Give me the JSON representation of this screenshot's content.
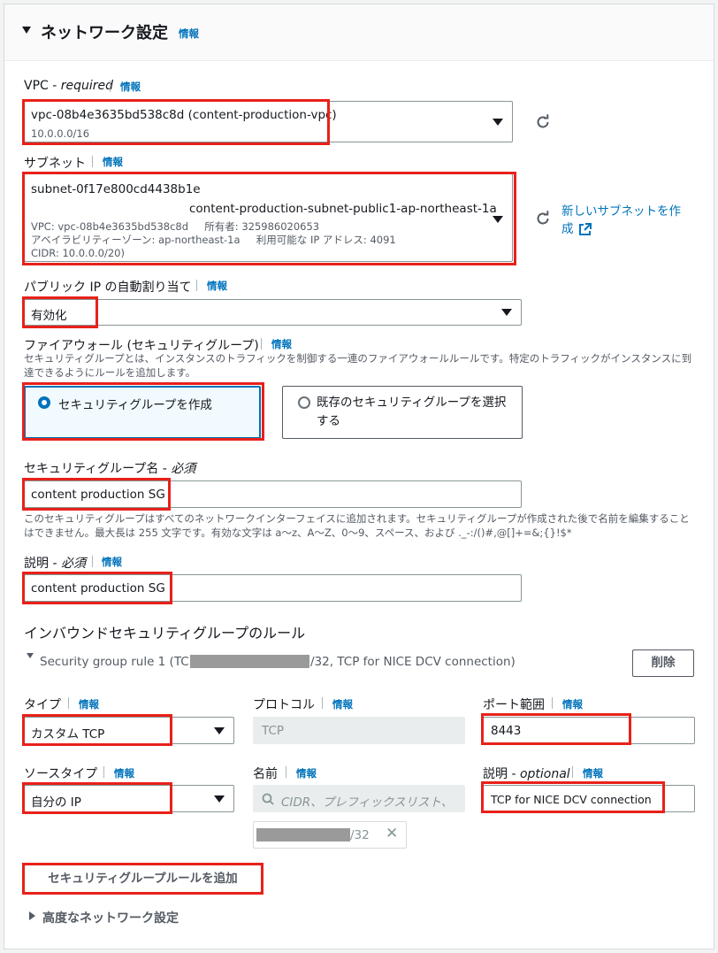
{
  "section": {
    "title": "ネットワーク設定",
    "info": "情報"
  },
  "vpc": {
    "label": "VPC - ",
    "label_italic": "required",
    "info": "情報",
    "value": "vpc-08b4e3635bd538c8d (content-production-vpc)",
    "sub": "10.0.0.0/16"
  },
  "subnet": {
    "label": "サブネット",
    "info": "情報",
    "id": "subnet-0f17e800cd4438b1e",
    "name": "content-production-subnet-public1-ap-northeast-1a",
    "detail1": "VPC: vpc-08b4e3635bd538c8d     所有者: 325986020653",
    "detail2": "アベイラビリティーゾーン: ap-northeast-1a     利用可能な IP アドレス: 4091",
    "detail3": "CIDR: 10.0.0.0/20)",
    "new_link": "新しいサブネットを作成"
  },
  "public_ip": {
    "label": "パブリック IP の自動割り当て",
    "info": "情報",
    "value": "有効化"
  },
  "firewall": {
    "label": "ファイアウォール (セキュリティグループ)",
    "info": "情報",
    "desc": "セキュリティグループとは、インスタンスのトラフィックを制御する一連のファイアウォールルールです。特定のトラフィックがインスタンスに到達できるようにルールを追加します。",
    "option_create": "セキュリティグループを作成",
    "option_existing": "既存のセキュリティグループを選択する"
  },
  "sg_name": {
    "label": "セキュリティグループ名 - ",
    "label_italic": "必須",
    "value": "content production SG",
    "hint": "このセキュリティグループはすべてのネットワークインターフェイスに追加されます。セキュリティグループが作成された後で名前を編集することはできません。最大長は 255 文字です。有効な文字は a〜z、A〜Z、0〜9、スペース、および ._-:/()#,@[]+=&;{}!$*"
  },
  "description": {
    "label": "説明 - ",
    "label_italic": "必須",
    "info": "情報",
    "value": "content production SG"
  },
  "inbound": {
    "title": "インバウンドセキュリティグループのルール",
    "rule_prefix": "Security group rule 1 (TCP, 8",
    "rule_suffix": "/32, TCP for NICE DCV connection)",
    "delete": "削除",
    "type_label": "タイプ",
    "type_value": "カスタム TCP",
    "protocol_label": "プロトコル",
    "protocol_value": "TCP",
    "port_label": "ポート範囲",
    "port_value": "8443",
    "source_label": "ソースタイプ",
    "source_value": "自分の IP",
    "name_label": "名前",
    "name_placeholder": "CIDR、プレフィックスリスト、",
    "cidr_suffix": "/32",
    "desc_label": "説明 - ",
    "desc_label_italic": "optional",
    "desc_value": "TCP for NICE DCV connection",
    "info": "情報",
    "add_rule": "セキュリティグループルールを追加"
  },
  "advanced": {
    "label": "高度なネットワーク設定"
  }
}
